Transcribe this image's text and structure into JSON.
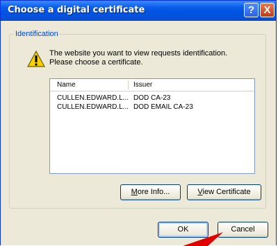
{
  "window": {
    "title": "Choose a digital certificate"
  },
  "title_buttons": {
    "help": "?",
    "close": "X"
  },
  "group": {
    "label": "Identification"
  },
  "message": {
    "line1": "The website you want to view requests identification.",
    "line2": "Please choose a certificate."
  },
  "list": {
    "columns": [
      "Name",
      "Issuer"
    ],
    "rows": [
      {
        "name": "CULLEN.EDWARD.L...",
        "issuer": "DOD CA-23"
      },
      {
        "name": "CULLEN.EDWARD.L...",
        "issuer": "DOD EMAIL CA-23"
      }
    ]
  },
  "buttons": {
    "more_info": {
      "accel": "M",
      "rest": "ore Info..."
    },
    "view_certificate": {
      "accel": "V",
      "rest": "iew Certificate"
    },
    "ok": "OK",
    "cancel": "Cancel"
  },
  "colors": {
    "title_blue": "#0054e3",
    "close_red": "#c23c12",
    "arrow_red": "#e00000"
  },
  "icons": [
    "warning-icon",
    "help-icon",
    "close-icon",
    "arrow-pointer-icon"
  ]
}
